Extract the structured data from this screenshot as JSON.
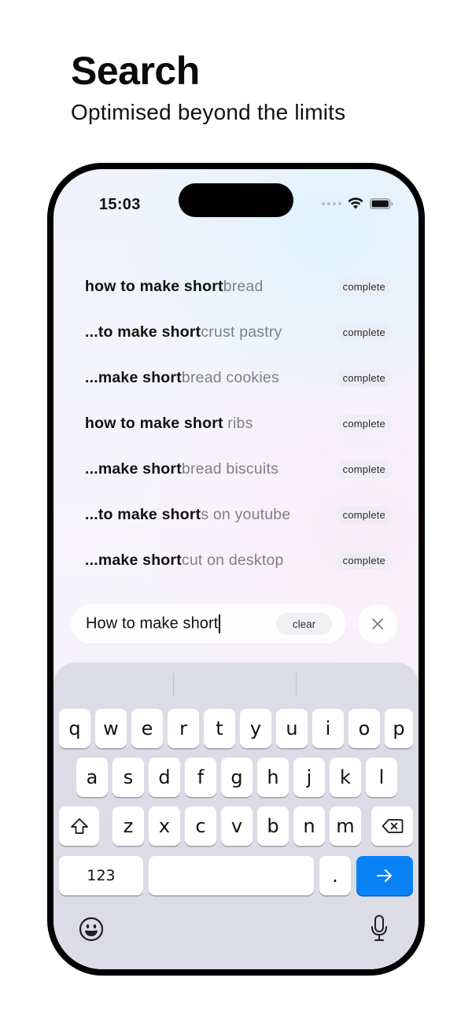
{
  "header": {
    "title": "Search",
    "subtitle": "Optimised beyond the limits"
  },
  "status_bar": {
    "time": "15:03"
  },
  "suggestions": [
    {
      "typed": "how to make short",
      "rest": "bread",
      "action": "complete"
    },
    {
      "typed": "...to make short",
      "rest": "crust pastry",
      "action": "complete"
    },
    {
      "typed": "...make short",
      "rest": "bread cookies",
      "action": "complete"
    },
    {
      "typed": "how to make short",
      "rest": " ribs",
      "action": "complete"
    },
    {
      "typed": "...make short",
      "rest": "bread biscuits",
      "action": "complete"
    },
    {
      "typed": "...to make short",
      "rest": "s on youtube",
      "action": "complete"
    },
    {
      "typed": "...make short",
      "rest": "cut on desktop",
      "action": "complete"
    }
  ],
  "search": {
    "value": "How to make short",
    "clear_label": "clear",
    "close_icon": "close-icon"
  },
  "keyboard": {
    "row1": [
      "q",
      "w",
      "e",
      "r",
      "t",
      "y",
      "u",
      "i",
      "o",
      "p"
    ],
    "row2": [
      "a",
      "s",
      "d",
      "f",
      "g",
      "h",
      "j",
      "k",
      "l"
    ],
    "row3": [
      "z",
      "x",
      "c",
      "v",
      "b",
      "n",
      "m"
    ],
    "numbers_label": "123",
    "period_label": ".",
    "icons": [
      "shift-icon",
      "delete-icon",
      "return-arrow-icon",
      "emoji-icon",
      "mic-icon"
    ]
  },
  "colors": {
    "accent": "#0a82f5",
    "keyboard_bg": "#dcdce6",
    "suggestion_dim": "#7e8089"
  }
}
